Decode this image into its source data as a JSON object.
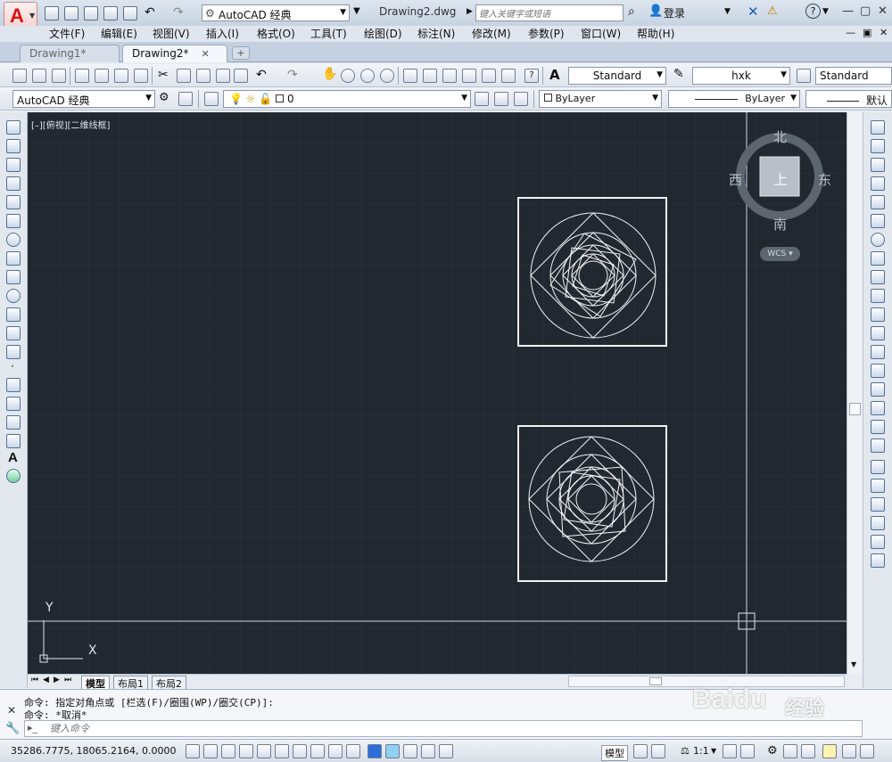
{
  "app": {
    "logo_letter": "A",
    "window_title": "Drawing2.dwg"
  },
  "quick_access": {
    "workspace": "AutoCAD 经典"
  },
  "search": {
    "placeholder": "键入关键字或短语"
  },
  "account": {
    "login_label": "登录"
  },
  "menu": {
    "items": [
      "文件(F)",
      "编辑(E)",
      "视图(V)",
      "插入(I)",
      "格式(O)",
      "工具(T)",
      "绘图(D)",
      "标注(N)",
      "修改(M)",
      "参数(P)",
      "窗口(W)",
      "帮助(H)"
    ]
  },
  "doc_tabs": [
    {
      "label": "Drawing1*"
    },
    {
      "label": "Drawing2*"
    }
  ],
  "toolbar": {
    "text_style": "Standard",
    "dim_style": "hxk",
    "table_style": "Standard",
    "workspace": "AutoCAD 经典",
    "layer": "0",
    "color": "ByLayer",
    "linetype": "ByLayer",
    "lineweight": "默认"
  },
  "viewport": {
    "label": "[–][俯视][二维线框]"
  },
  "viewcube": {
    "north": "北",
    "south": "南",
    "east": "东",
    "west": "西",
    "top": "上",
    "wcs": "WCS"
  },
  "ucs": {
    "x": "X",
    "y": "Y"
  },
  "layout_tabs": [
    "模型",
    "布局1",
    "布局2"
  ],
  "command": {
    "history": [
      "命令: 指定对角点或 [栏选(F)/圈围(WP)/圈交(CP)]:",
      "命令: *取消*"
    ],
    "placeholder": "键入命令"
  },
  "status": {
    "coordinates": "35286.7775, 18065.2164, 0.0000",
    "model_label": "模型",
    "scale": "1:1"
  },
  "watermark": {
    "text": "Baidu",
    "text2": "经验"
  },
  "colors": {
    "canvas": "#212830",
    "accent": "#cc1111"
  }
}
